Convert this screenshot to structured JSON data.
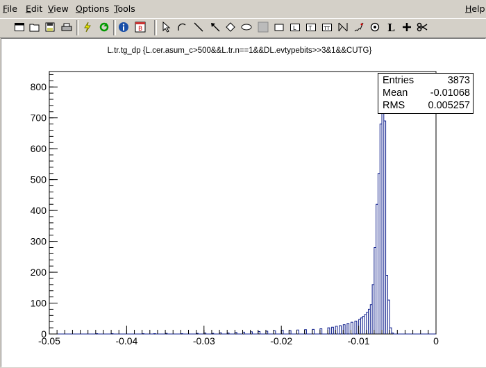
{
  "menu": {
    "file": {
      "u": "F",
      "rest": "ile"
    },
    "edit": {
      "u": "E",
      "rest": "dit"
    },
    "view": {
      "u": "V",
      "rest": "iew"
    },
    "options": {
      "u": "O",
      "rest": "ptions"
    },
    "tools": {
      "u": "T",
      "rest": "ools"
    },
    "help": {
      "u": "H",
      "rest": "elp"
    }
  },
  "toolbar_icons": [
    "new-canvas",
    "open",
    "save",
    "print",
    "interrupt",
    "refresh",
    "inspect",
    "browser",
    "pointer",
    "arc",
    "line",
    "arrow",
    "diamond",
    "ellipse",
    "pad",
    "pave",
    "pave-label",
    "pave-text",
    "pave-text-multi",
    "graph",
    "curly-line",
    "marker",
    "latex",
    "crosshair",
    "cut"
  ],
  "plot": {
    "title": "L.tr.tg_dp {L.cer.asum_c>500&&L.tr.n==1&&DL.evtypebits>>3&1&&CUTG}",
    "stats": {
      "entries_label": "Entries",
      "entries_value": "3873",
      "mean_label": "Mean",
      "mean_value": "-0.01068",
      "rms_label": "RMS",
      "rms_value": "0.005257"
    }
  },
  "chart_data": {
    "type": "histogram",
    "title": "L.tr.tg_dp {L.cer.asum_c>500&&L.tr.n==1&&DL.evtypebits>>3&1&&CUTG}",
    "xlabel": "",
    "ylabel": "",
    "xlim": [
      -0.05,
      0.0
    ],
    "ylim": [
      0,
      850
    ],
    "x_ticks": [
      -0.05,
      -0.04,
      -0.03,
      -0.02,
      -0.01,
      0
    ],
    "x_tick_labels": [
      "-0.05",
      "-0.04",
      "-0.03",
      "-0.02",
      "-0.01",
      "0"
    ],
    "y_ticks": [
      0,
      100,
      200,
      300,
      400,
      500,
      600,
      700,
      800
    ],
    "y_tick_labels": [
      "0",
      "100",
      "200",
      "300",
      "400",
      "500",
      "600",
      "700",
      "800"
    ],
    "bin_width": 0.00025,
    "bins": [
      [
        -0.044,
        1
      ],
      [
        -0.042,
        1
      ],
      [
        -0.038,
        1
      ],
      [
        -0.0365,
        1
      ],
      [
        -0.035,
        2
      ],
      [
        -0.033,
        1
      ],
      [
        -0.031,
        2
      ],
      [
        -0.03,
        3
      ],
      [
        -0.029,
        2
      ],
      [
        -0.028,
        4
      ],
      [
        -0.027,
        3
      ],
      [
        -0.026,
        5
      ],
      [
        -0.025,
        6
      ],
      [
        -0.024,
        7
      ],
      [
        -0.023,
        8
      ],
      [
        -0.022,
        9
      ],
      [
        -0.021,
        10
      ],
      [
        -0.02,
        12
      ],
      [
        -0.019,
        11
      ],
      [
        -0.018,
        13
      ],
      [
        -0.017,
        14
      ],
      [
        -0.016,
        15
      ],
      [
        -0.015,
        17
      ],
      [
        -0.014,
        20
      ],
      [
        -0.0135,
        22
      ],
      [
        -0.013,
        25
      ],
      [
        -0.0125,
        27
      ],
      [
        -0.012,
        30
      ],
      [
        -0.0115,
        34
      ],
      [
        -0.011,
        38
      ],
      [
        -0.0105,
        42
      ],
      [
        -0.01,
        47
      ],
      [
        -0.00975,
        52
      ],
      [
        -0.0095,
        57
      ],
      [
        -0.00925,
        63
      ],
      [
        -0.009,
        70
      ],
      [
        -0.00875,
        80
      ],
      [
        -0.0085,
        95
      ],
      [
        -0.00825,
        160
      ],
      [
        -0.008,
        280
      ],
      [
        -0.00775,
        420
      ],
      [
        -0.0075,
        520
      ],
      [
        -0.00725,
        680
      ],
      [
        -0.007,
        790
      ],
      [
        -0.00675,
        690
      ],
      [
        -0.0065,
        190
      ],
      [
        -0.00625,
        110
      ],
      [
        -0.006,
        20
      ],
      [
        -0.00575,
        3
      ]
    ]
  }
}
